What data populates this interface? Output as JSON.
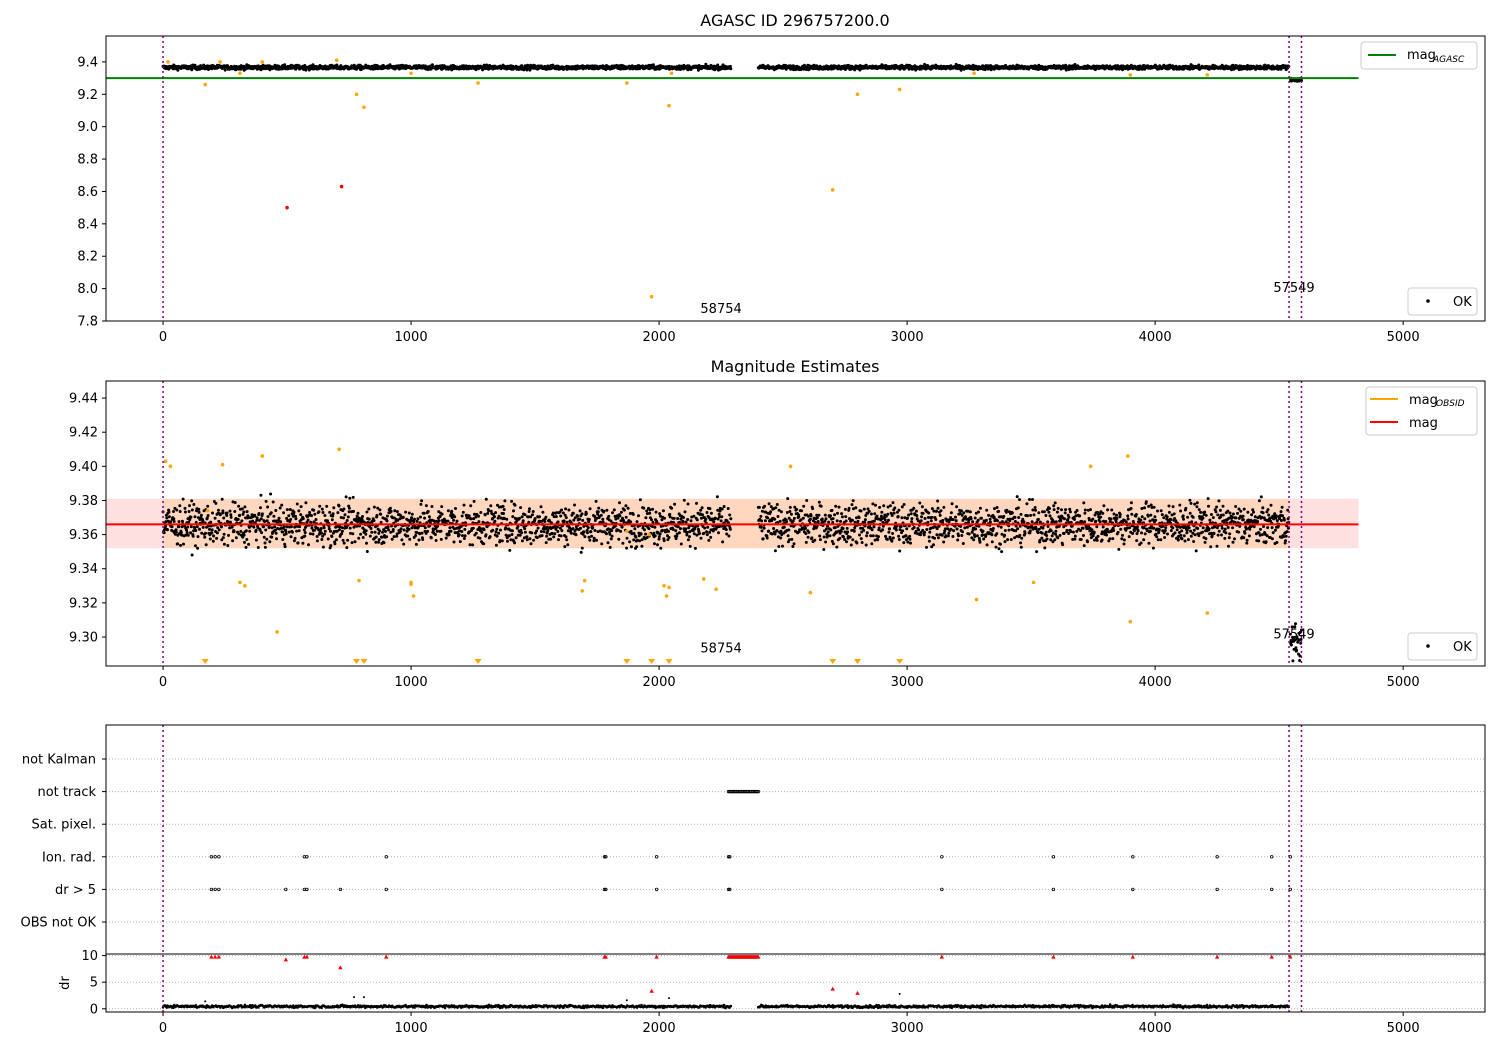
{
  "chart_data": [
    {
      "type": "scatter",
      "title": "AGASC ID 296757200.0",
      "xlim": [
        -230,
        5330
      ],
      "ylim": [
        7.8,
        9.56
      ],
      "xticks": [
        0,
        1000,
        2000,
        3000,
        4000,
        5000
      ],
      "yticks": [
        7.8,
        8.0,
        8.2,
        8.4,
        8.6,
        8.8,
        9.0,
        9.2,
        9.4
      ],
      "ytick_labels": [
        "7.8",
        "8.0",
        "8.2",
        "8.4",
        "8.6",
        "8.8",
        "9.0",
        "9.2",
        "9.4"
      ],
      "hline": {
        "value": 9.3,
        "x_range": [
          -230,
          4820
        ],
        "color": "#008000"
      },
      "vlines": [
        0,
        4540,
        4590
      ],
      "vline_color": "#800080",
      "annotations": [
        {
          "text": "58754",
          "x": 2250,
          "y": 7.85
        },
        {
          "text": "57549",
          "x": 4560,
          "y": 7.98
        }
      ],
      "legends": [
        {
          "entries": [
            {
              "label": "mag",
              "sub": "AGASC",
              "kind": "line",
              "color": "#008000"
            }
          ],
          "position": "upper right"
        },
        {
          "entries": [
            {
              "label": "OK",
              "kind": "marker",
              "color": "#000000"
            }
          ],
          "position": "lower right"
        }
      ],
      "series": [
        {
          "name": "OK",
          "kind": "band",
          "segments": [
            [
              0,
              2290
            ],
            [
              2400,
              4540
            ]
          ],
          "center": 9.366,
          "noise": 0.012,
          "color": "#000000"
        },
        {
          "kind": "band",
          "segments": [
            [
              4545,
              4590
            ]
          ],
          "center": 9.29,
          "noise": 0.01,
          "color": "#000000"
        },
        {
          "kind": "points",
          "color": "#FFA500",
          "x": [
            20,
            170,
            230,
            310,
            400,
            700,
            780,
            810,
            1000,
            1270,
            1870,
            1970,
            2040,
            2050,
            2700,
            2800,
            2970,
            3270,
            3900,
            4210
          ],
          "y": [
            9.4,
            9.26,
            9.4,
            9.33,
            9.4,
            9.41,
            9.2,
            9.12,
            9.33,
            9.27,
            9.27,
            7.95,
            9.13,
            9.33,
            8.61,
            9.2,
            9.23,
            9.33,
            9.32,
            9.32
          ]
        },
        {
          "kind": "points",
          "color": "#FF0000",
          "x": [
            500,
            720
          ],
          "y": [
            8.5,
            8.63
          ]
        }
      ]
    },
    {
      "type": "scatter",
      "title": "Magnitude Estimates",
      "xlim": [
        -230,
        5330
      ],
      "ylim": [
        9.283,
        9.45
      ],
      "xticks": [
        0,
        1000,
        2000,
        3000,
        4000,
        5000
      ],
      "yticks": [
        9.3,
        9.32,
        9.34,
        9.36,
        9.38,
        9.4,
        9.42,
        9.44
      ],
      "ytick_labels": [
        "9.30",
        "9.32",
        "9.34",
        "9.36",
        "9.38",
        "9.40",
        "9.42",
        "9.44"
      ],
      "hline": {
        "value": 9.366,
        "x_range": [
          -230,
          4820
        ],
        "color": "#FF0000"
      },
      "band": {
        "y_range": [
          9.352,
          9.381
        ],
        "x_range": [
          -230,
          4820
        ],
        "color": "#FF0000"
      },
      "band_inner": {
        "y_range": [
          9.352,
          9.381
        ],
        "x_range": [
          0,
          4540
        ],
        "color": "#FFA500"
      },
      "vlines": [
        0,
        4540,
        4590
      ],
      "vline_color": "#800080",
      "annotations": [
        {
          "text": "58754",
          "x": 2250,
          "y": 9.291
        },
        {
          "text": "57549",
          "x": 4560,
          "y": 9.299
        }
      ],
      "legends": [
        {
          "entries": [
            {
              "label": "mag",
              "sub": "OBSID",
              "kind": "line",
              "color": "#FFA500"
            },
            {
              "label": "mag",
              "kind": "line",
              "color": "#FF0000"
            }
          ],
          "position": "upper right"
        },
        {
          "entries": [
            {
              "label": "OK",
              "kind": "marker",
              "color": "#000000"
            }
          ],
          "position": "lower right"
        }
      ],
      "series": [
        {
          "name": "OK",
          "kind": "band",
          "segments": [
            [
              0,
              2290
            ],
            [
              2400,
              4540
            ]
          ],
          "center": 9.366,
          "noise": 0.011,
          "color": "#000000"
        },
        {
          "kind": "band",
          "segments": [
            [
              4545,
              4590
            ]
          ],
          "center": 9.297,
          "noise": 0.009,
          "color": "#000000"
        },
        {
          "kind": "points",
          "color": "#FFA500",
          "x": [
            10,
            30,
            180,
            240,
            310,
            330,
            400,
            460,
            710,
            790,
            1000,
            1000,
            1010,
            1690,
            1700,
            1870,
            1960,
            2020,
            2030,
            2040,
            2180,
            2230,
            2530,
            2610,
            3280,
            3510,
            3740,
            3890,
            3900,
            4210
          ],
          "y": [
            9.403,
            9.4,
            9.374,
            9.401,
            9.332,
            9.33,
            9.406,
            9.303,
            9.41,
            9.333,
            9.332,
            9.331,
            9.324,
            9.327,
            9.333,
            9.362,
            9.36,
            9.33,
            9.324,
            9.329,
            9.334,
            9.328,
            9.4,
            9.326,
            9.322,
            9.332,
            9.4,
            9.406,
            9.309,
            9.314
          ]
        },
        {
          "kind": "triangles",
          "color": "#FFA500",
          "x": [
            170,
            780,
            810,
            1270,
            1870,
            1970,
            2040,
            2700,
            2800,
            2970
          ]
        }
      ]
    },
    {
      "type": "scatter",
      "title": "",
      "xlim": [
        -230,
        5330
      ],
      "xticks": [
        0,
        1000,
        2000,
        3000,
        4000,
        5000
      ],
      "vlines": [
        0,
        4540,
        4590
      ],
      "vline_color": "#800080",
      "flag_rows": [
        "not Kalman",
        "not track",
        "Sat. pixel.",
        "Ion. rad.",
        "dr > 5",
        "OBS not OK"
      ],
      "flags": {
        "not track": {
          "x_range": [
            2280,
            2400
          ]
        },
        "Ion. rad.": {
          "x": [
            195,
            210,
            225,
            570,
            580,
            900,
            1780,
            1785,
            1990,
            2280,
            2285,
            3140,
            3590,
            3910,
            4250,
            4470,
            4545
          ]
        },
        "dr > 5": {
          "x": [
            195,
            210,
            225,
            495,
            570,
            580,
            715,
            900,
            1780,
            1785,
            1990,
            2280,
            2285,
            3140,
            3590,
            3910,
            4250,
            4470,
            4545
          ]
        }
      },
      "dr_panel": {
        "ylabel": "dr",
        "ylim": [
          -0.6,
          10.3
        ],
        "yticks": [
          0,
          5,
          10
        ],
        "ytick_labels": [
          "0",
          "5",
          "10"
        ],
        "ok_segments": [
          [
            0,
            2290
          ],
          [
            2400,
            4540
          ]
        ],
        "ok_level": 0.45,
        "black_outliers": {
          "x": [
            170,
            770,
            810,
            1870,
            2040,
            2970
          ],
          "y": [
            1.4,
            2.2,
            2.2,
            1.6,
            2.0,
            2.8
          ]
        },
        "red": {
          "x": [
            195,
            210,
            225,
            495,
            570,
            580,
            715,
            900,
            1780,
            1785,
            1990,
            1970,
            2700,
            2800,
            3140,
            3590,
            3910,
            4250,
            4470,
            4545
          ],
          "y": [
            9.8,
            9.8,
            9.8,
            9.3,
            9.8,
            9.8,
            7.8,
            9.8,
            9.8,
            9.8,
            9.8,
            3.4,
            3.8,
            3.0,
            9.8,
            9.8,
            9.8,
            9.8,
            9.8,
            9.8
          ]
        },
        "red_track": {
          "x_range": [
            2280,
            2400
          ],
          "y": 9.8
        }
      }
    }
  ]
}
